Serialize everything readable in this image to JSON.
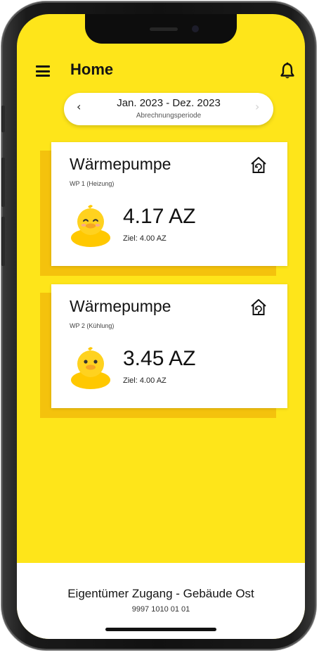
{
  "header": {
    "title": "Home",
    "menu_icon": "hamburger-icon",
    "bell_icon": "bell-icon"
  },
  "period": {
    "range": "Jan. 2023 - Dez. 2023",
    "label": "Abrechnungsperiode",
    "prev_icon": "chevron-left-icon",
    "next_icon": "chevron-right-icon"
  },
  "cards": [
    {
      "title": "Wärmepumpe",
      "subtitle": "WP 1 (Heizung)",
      "value": "4.17 AZ",
      "target": "Ziel: 4.00 AZ",
      "icon": "house-heatpump-icon",
      "mascot": "happy-duck"
    },
    {
      "title": "Wärmepumpe",
      "subtitle": "WP 2 (Kühlung)",
      "value": "3.45 AZ",
      "target": "Ziel: 4.00 AZ",
      "icon": "house-heatpump-icon",
      "mascot": "neutral-duck"
    }
  ],
  "footer": {
    "title": "Eigentümer Zugang - Gebäude Ost",
    "id": "9997 1010 01 01"
  },
  "colors": {
    "background": "#FEE51A",
    "card_shadow": "#F4C20D",
    "card": "#FFFFFF",
    "duck": "#FFD21F",
    "beak": "#F5A623"
  }
}
